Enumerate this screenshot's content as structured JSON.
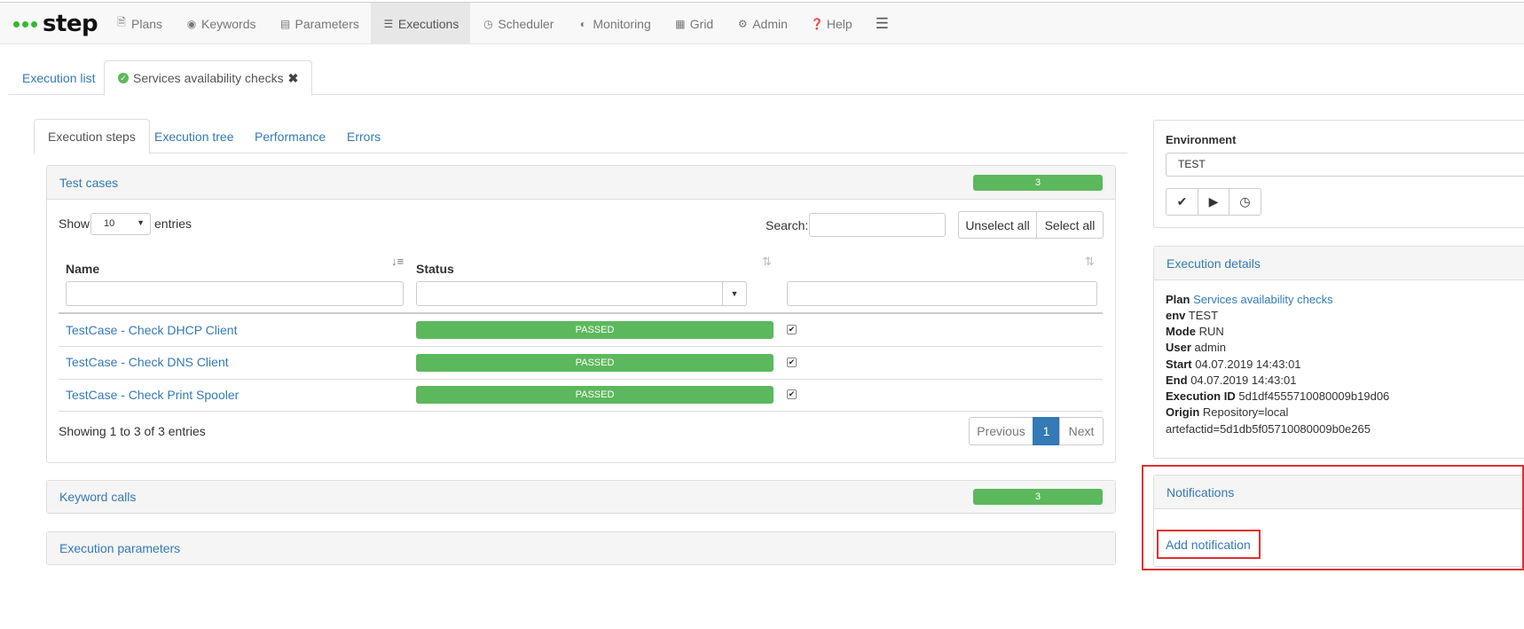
{
  "app": {
    "logo_text": "step"
  },
  "nav": [
    {
      "label": "Plans",
      "icon": "file-icon"
    },
    {
      "label": "Keywords",
      "icon": "target-icon"
    },
    {
      "label": "Parameters",
      "icon": "list-icon"
    },
    {
      "label": "Executions",
      "icon": "server-icon",
      "active": true
    },
    {
      "label": "Scheduler",
      "icon": "clock-icon"
    },
    {
      "label": "Monitoring",
      "icon": "gauge-icon"
    },
    {
      "label": "Grid",
      "icon": "grid-icon"
    },
    {
      "label": "Admin",
      "icon": "gear-icon"
    },
    {
      "label": "Help",
      "icon": "question-icon"
    }
  ],
  "page_tabs": {
    "list": "Execution list",
    "current": "Services availability checks"
  },
  "sub_tabs": [
    "Execution steps",
    "Execution tree",
    "Performance",
    "Errors"
  ],
  "test_cases": {
    "title": "Test cases",
    "count": "3",
    "show": "Show",
    "entries_value": "10",
    "entries": "entries",
    "search_label": "Search:",
    "search_value": "",
    "unselect_all": "Unselect all",
    "select_all": "Select all",
    "columns": [
      "Name",
      "Status",
      ""
    ],
    "rows": [
      {
        "name": "TestCase - Check DHCP Client",
        "status": "PASSED",
        "checked": true
      },
      {
        "name": "TestCase - Check DNS Client",
        "status": "PASSED",
        "checked": true
      },
      {
        "name": "TestCase - Check Print Spooler",
        "status": "PASSED",
        "checked": true
      }
    ],
    "info": "Showing 1 to 3 of 3 entries",
    "pagination": {
      "previous": "Previous",
      "page": "1",
      "next": "Next"
    }
  },
  "keyword_calls": {
    "title": "Keyword calls",
    "count": "3"
  },
  "execution_parameters": {
    "title": "Execution parameters"
  },
  "environment": {
    "title": "Environment",
    "value": "TEST"
  },
  "execution_details": {
    "title": "Execution details",
    "plan_label": "Plan",
    "plan_value": "Services availability checks",
    "env_label": "env",
    "env_value": "TEST",
    "mode_label": "Mode",
    "mode_value": "RUN",
    "user_label": "User",
    "user_value": "admin",
    "start_label": "Start",
    "start_value": "04.07.2019 14:43:01",
    "end_label": "End",
    "end_value": "04.07.2019 14:43:01",
    "id_label": "Execution ID",
    "id_value": "5d1df4555710080009b19d06",
    "origin_label": "Origin",
    "origin_value": "Repository=local",
    "origin_value2": "artefactid=5d1db5f05710080009b0e265"
  },
  "notifications": {
    "title": "Notifications",
    "add": "Add notification"
  },
  "colors": {
    "accent": "#337ab7",
    "success": "#5cb85c",
    "highlight": "#e03030"
  }
}
